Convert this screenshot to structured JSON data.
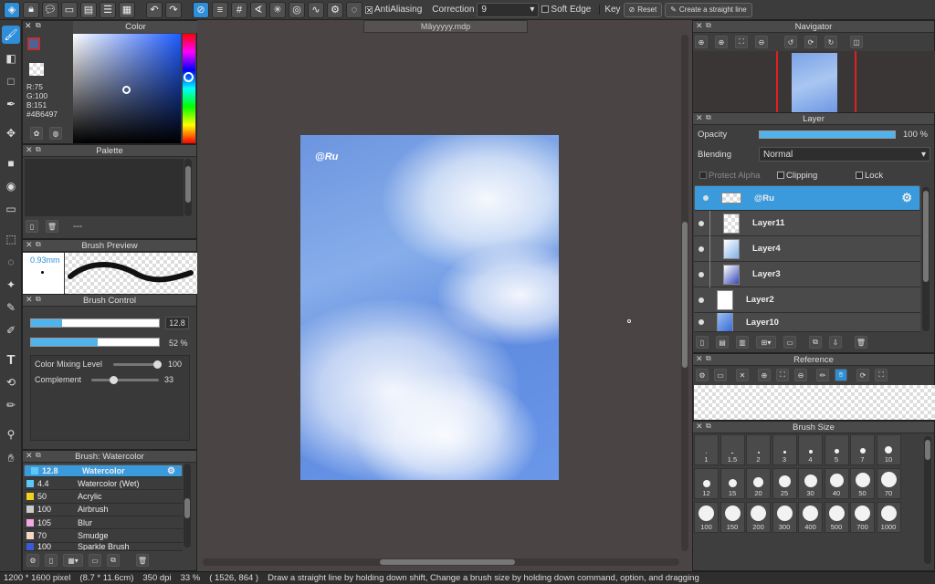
{
  "toolbar": {
    "antialiasing_label": "AntiAliasing",
    "correction_label": "Correction",
    "correction_value": "9",
    "soft_edge_label": "Soft Edge",
    "key_label": "Key",
    "reset_label": "Reset",
    "straight_line_label": "Create a straight line"
  },
  "document": {
    "tab_title": "Mâyyyyy.mdp"
  },
  "artwork": {
    "signature": "@Ru"
  },
  "color_panel": {
    "title": "Color",
    "r": "R:75",
    "g": "G:100",
    "b": "B:151",
    "hex": "#4B6497",
    "current_color": "#4b6497"
  },
  "palette_panel": {
    "title": "Palette",
    "name": "---"
  },
  "brush_preview": {
    "title": "Brush Preview",
    "size": "0.93mm"
  },
  "brush_control": {
    "title": "Brush Control",
    "size_value": "12.8",
    "size_fraction": 0.24,
    "opacity_value": "52 %",
    "opacity_fraction": 0.52,
    "color_mixing_label": "Color Mixing Level",
    "color_mixing_value": "100",
    "complement_label": "Complement",
    "complement_value": "33"
  },
  "brush_list": {
    "title": "Brush: Watercolor",
    "items": [
      {
        "size": "12.8",
        "name": "Watercolor",
        "color": "#5bc8f5"
      },
      {
        "size": "4.4",
        "name": "Watercolor (Wet)",
        "color": "#5bc8f5"
      },
      {
        "size": "50",
        "name": "Acrylic",
        "color": "#f2d21b"
      },
      {
        "size": "100",
        "name": "Airbrush",
        "color": "#cccccc"
      },
      {
        "size": "105",
        "name": "Blur",
        "color": "#f0a8e6"
      },
      {
        "size": "70",
        "name": "Smudge",
        "color": "#f5d6c2"
      },
      {
        "size": "100",
        "name": "Sparkle Brush",
        "color": "#3a5ad9"
      }
    ]
  },
  "navigator": {
    "title": "Navigator"
  },
  "layer_panel": {
    "title": "Layer",
    "opacity_label": "Opacity",
    "opacity_value": "100 %",
    "blending_label": "Blending",
    "blending_value": "Normal",
    "protect_alpha_label": "Protect Alpha",
    "clipping_label": "Clipping",
    "lock_label": "Lock",
    "layers": [
      "@Ru",
      "Layer11",
      "Layer4",
      "Layer3",
      "Layer2",
      "Layer10"
    ]
  },
  "reference": {
    "title": "Reference"
  },
  "brush_size": {
    "title": "Brush Size",
    "sizes": [
      "1",
      "1.5",
      "2",
      "3",
      "4",
      "5",
      "7",
      "10",
      "12",
      "15",
      "20",
      "25",
      "30",
      "40",
      "50",
      "70",
      "100",
      "150",
      "200",
      "300",
      "400",
      "500",
      "700",
      "1000"
    ]
  },
  "status": {
    "dimensions": "1200 * 1600 pixel",
    "physical": "(8.7 * 11.6cm)",
    "dpi": "350 dpi",
    "zoom": "33 %",
    "cursor": "( 1526, 864 )",
    "hint": "Draw a straight line by holding down shift, Change a brush size by holding down command, option, and dragging"
  }
}
